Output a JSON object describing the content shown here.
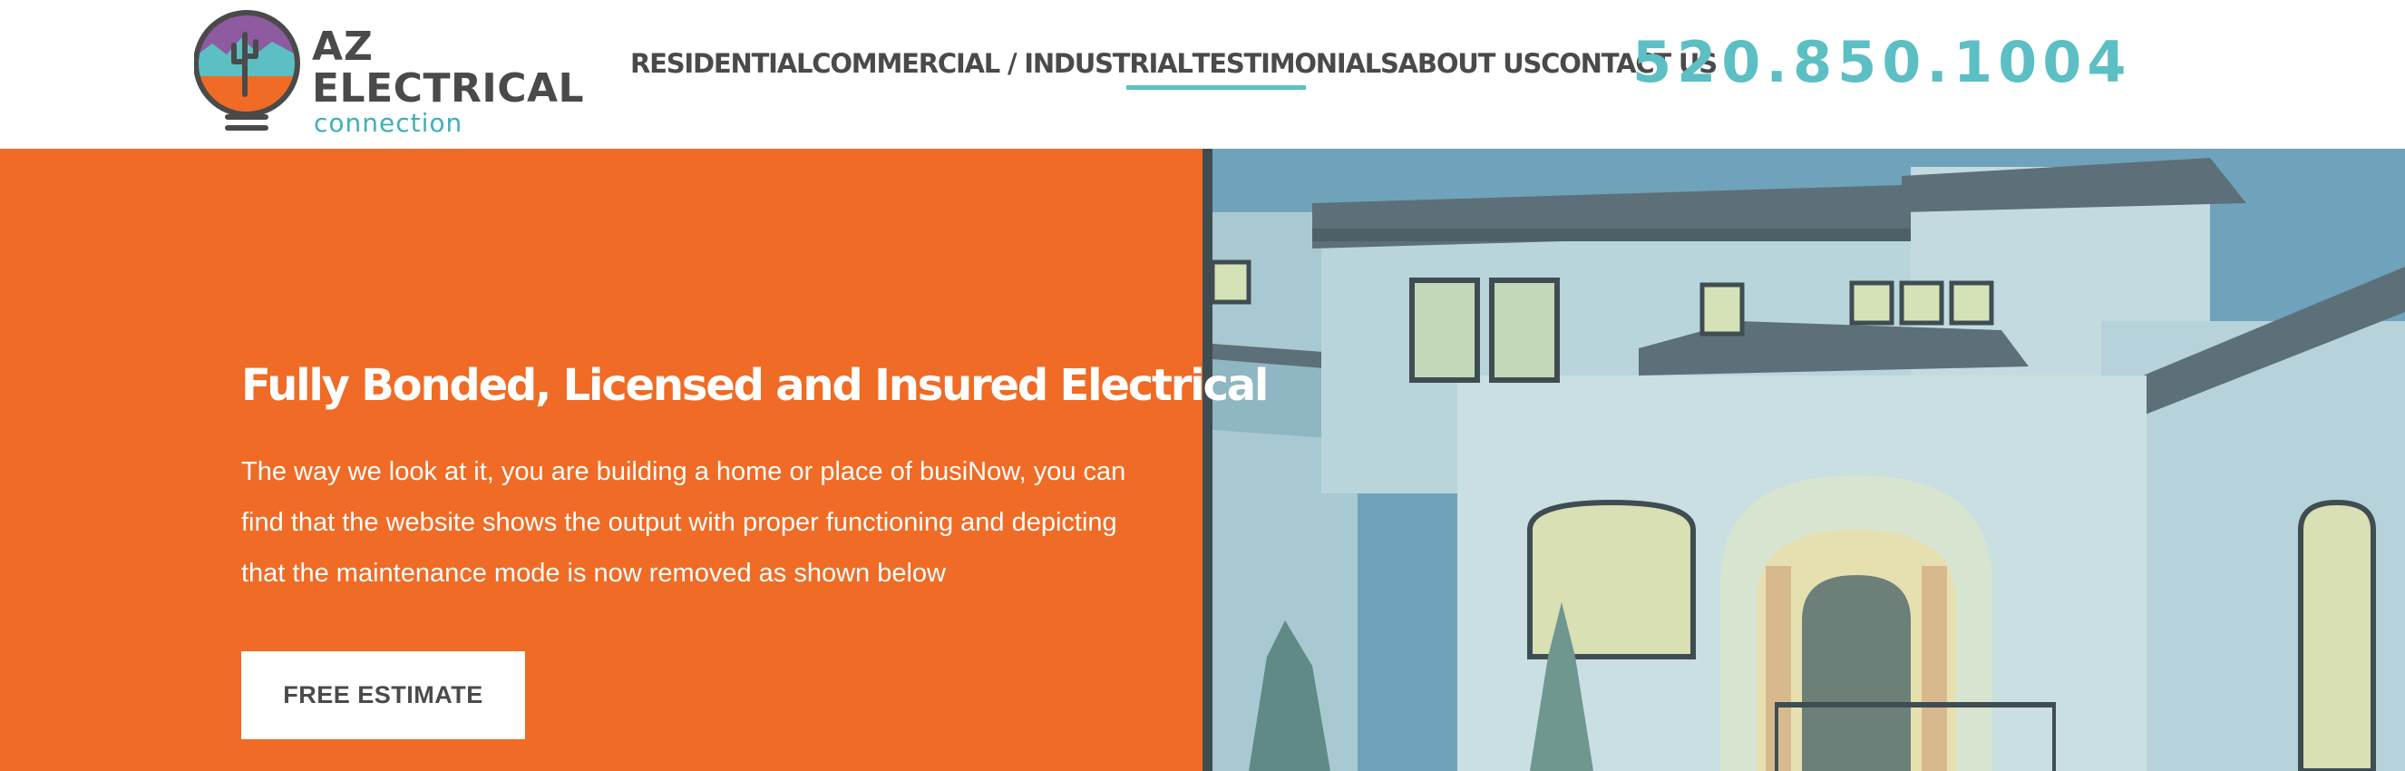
{
  "brand": {
    "line1": "AZ",
    "line2": "ELECTRICAL",
    "line3": "connection",
    "colors": {
      "purple": "#8e5aa0",
      "teal": "#5cbfc4",
      "orange": "#f06b25",
      "dark": "#4a4a4a"
    }
  },
  "nav": {
    "items": [
      {
        "label": "RESIDENTIAL",
        "active": false
      },
      {
        "label": "COMMERCIAL / INDUSTRIAL",
        "active": false
      },
      {
        "label": "TESTIMONIALS",
        "active": true
      },
      {
        "label": "ABOUT US",
        "active": false
      },
      {
        "label": "CONTACT US",
        "active": false
      }
    ]
  },
  "phone": "520.850.1004",
  "hero": {
    "title": "Fully Bonded, Licensed and Insured Electrical",
    "body": "The way we look at it, you are building a home or place of busiNow, you can find that the website shows the output with proper functioning and depicting that the maintenance mode is now removed as shown below",
    "button_label": "FREE ESTIMATE",
    "image_subject": "luxury-house-photo",
    "colors": {
      "panel": "#f06b25",
      "divider": "#3f4d52",
      "overlay": "#6fa3bb"
    }
  }
}
